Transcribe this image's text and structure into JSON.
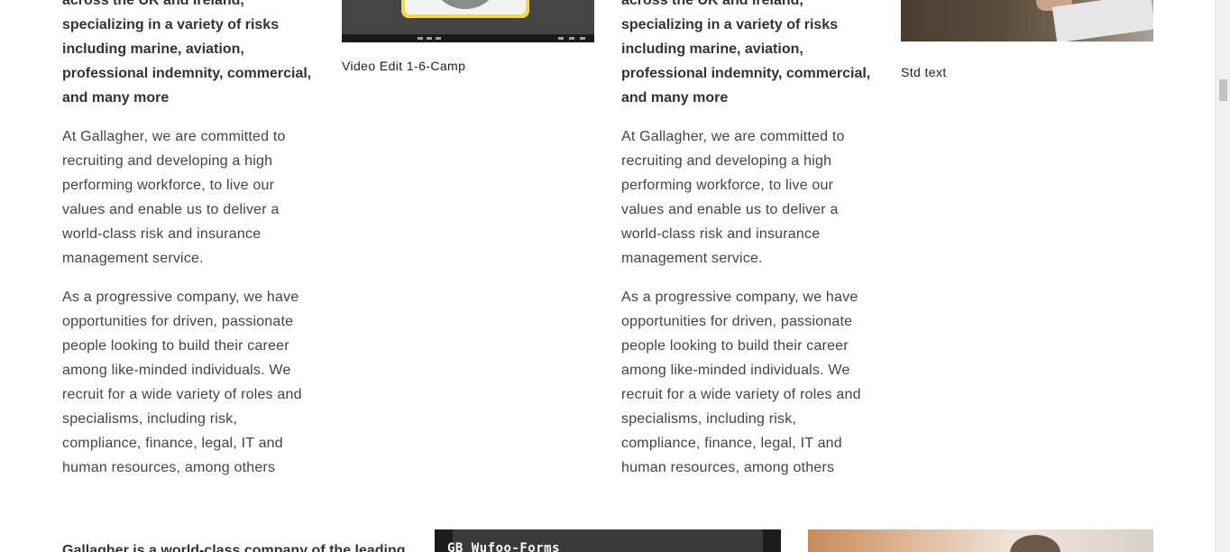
{
  "columns": [
    {
      "intro_lines": [
        "across the UK and Ireland,",
        "specializing in a variety of risks",
        "including marine, aviation,",
        "professional indemnity, commercial,",
        "and many more"
      ],
      "para1_lines": [
        "At Gallagher, we are committed to",
        "recruiting and developing a high",
        "performing workforce, to live our",
        "values and enable us to deliver a",
        "world-class risk and insurance",
        "management service."
      ],
      "para2_lines": [
        "As a progressive company, we have",
        "opportunities for driven, passionate",
        "people looking to build their career",
        "among like-minded individuals. We",
        "recruit for a wide variety of roles and",
        "specialisms, including risk,",
        "compliance, finance, legal, IT and",
        "human resources, among others"
      ]
    },
    {
      "intro_lines": [
        "across the UK and Ireland,",
        "specializing in a variety of risks",
        "including marine, aviation,",
        "professional indemnity, commercial,",
        "and many more"
      ],
      "para1_lines": [
        "At Gallagher, we are committed to",
        "recruiting and developing a high",
        "performing workforce, to live our",
        "values and enable us to deliver a",
        "world-class risk and insurance",
        "management service."
      ],
      "para2_lines": [
        "As a progressive company, we have",
        "opportunities for driven, passionate",
        "people looking to build their career",
        "among like-minded individuals. We",
        "recruit for a wide variety of roles and",
        "specialisms, including risk,",
        "compliance, finance, legal, IT and",
        "human resources, among others"
      ]
    }
  ],
  "video_card": {
    "caption": "Video Edit 1-6-Camp",
    "icon": "video-thumbnail"
  },
  "photo_card": {
    "caption": "Std text",
    "icon": "photo-thumbnail"
  },
  "bottom": {
    "heading": "Gallagher is a world-class company of the leading",
    "video_title": "GB_Wufoo-Forms"
  },
  "colors": {
    "text": "#333333",
    "body_text": "#444444",
    "background": "#ffffff",
    "video_bg": "#444444",
    "accent_yellow": "#f5d84a"
  }
}
